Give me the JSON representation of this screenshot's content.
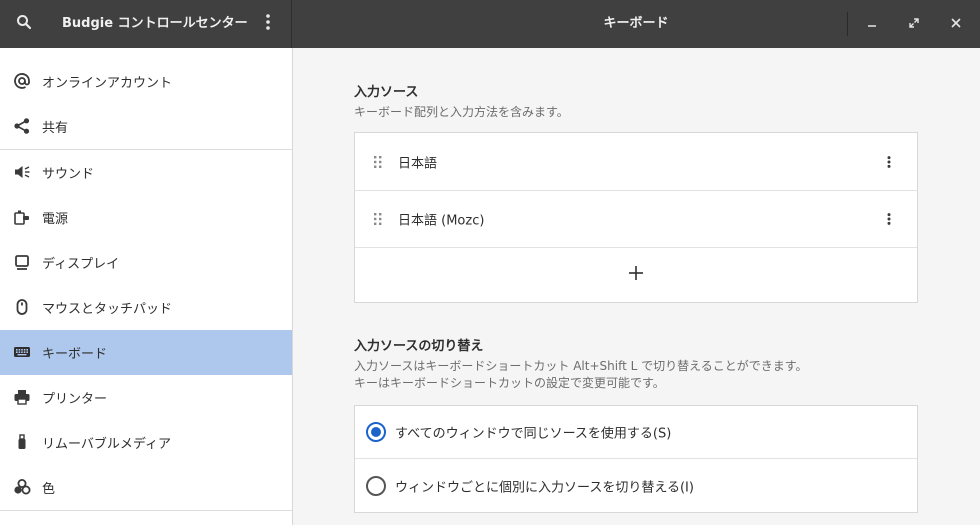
{
  "header": {
    "app_title": "Budgie コントロールセンター",
    "page_title": "キーボード",
    "search_icon": "search-icon",
    "menu_icon": "vertical-dots-icon",
    "window_controls": [
      "minimize-icon",
      "maximize-icon",
      "close-icon"
    ]
  },
  "sidebar": {
    "items": [
      {
        "label": "オンラインアカウント",
        "icon": "at-sign-icon"
      },
      {
        "label": "共有",
        "icon": "share-icon"
      },
      {
        "label": "サウンド",
        "icon": "speaker-icon"
      },
      {
        "label": "電源",
        "icon": "power-plug-icon"
      },
      {
        "label": "ディスプレイ",
        "icon": "monitor-icon"
      },
      {
        "label": "マウスとタッチパッド",
        "icon": "mouse-icon"
      },
      {
        "label": "キーボード",
        "icon": "keyboard-icon",
        "selected": true
      },
      {
        "label": "プリンター",
        "icon": "printer-icon"
      },
      {
        "label": "リムーバブルメディア",
        "icon": "usb-stick-icon"
      },
      {
        "label": "色",
        "icon": "color-icon"
      }
    ]
  },
  "input_sources": {
    "title": "入力ソース",
    "description": "キーボード配列と入力方法を含みます。",
    "sources": [
      {
        "label": "日本語"
      },
      {
        "label": "日本語 (Mozc)"
      }
    ],
    "add_icon": "plus-icon"
  },
  "switching": {
    "title": "入力ソースの切り替え",
    "description_line1": "入力ソースはキーボードショートカット Alt+Shift L で切り替えることができます。",
    "description_line2": "キーはキーボードショートカットの設定で変更可能です。",
    "options": [
      {
        "label": "すべてのウィンドウで同じソースを使用する(S)",
        "selected": true
      },
      {
        "label": "ウィンドウごとに個別に入力ソースを切り替える(I)",
        "selected": false
      }
    ]
  },
  "colors": {
    "headerbar": "#404040",
    "selected_row": "#adc8ec",
    "accent": "#1d63c9"
  }
}
